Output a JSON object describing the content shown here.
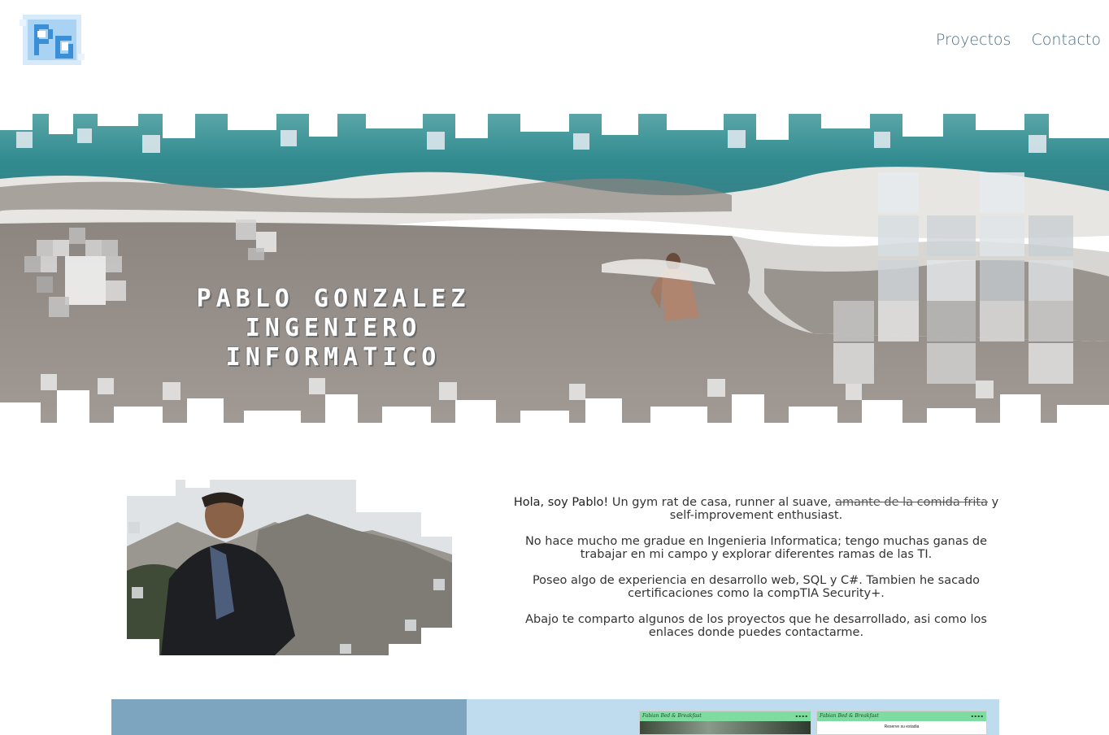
{
  "header": {
    "logo_text": "PG",
    "nav": [
      {
        "label": "Proyectos"
      },
      {
        "label": "Contacto"
      }
    ]
  },
  "hero": {
    "line1": "PABLO GONZALEZ",
    "line2": "INGENIERO INFORMATICO"
  },
  "about": {
    "p1_bold": "Hola, soy Pablo!",
    "p1_text": " Un gym rat de casa, runner al suave, ",
    "p1_strike": "amante de la comida frita",
    "p1_end": " y self-improvement enthusiast.",
    "p2": "No hace mucho me gradue en Ingenieria Informatica; tengo muchas ganas de trabajar en mi campo y explorar diferentes ramas de las TI.",
    "p3": "Poseo algo de experiencia en desarrollo web, SQL y C#. Tambien he sacado certificaciones como la compTIA Security+.",
    "p4": "Abajo te comparto algunos de los proyectos que he desarrollado, asi como los enlaces donde puedes contactarme."
  },
  "projects": {
    "thumb1_title": "Fabian Bed & Breakfast",
    "thumb2_title": "Fabian Bed & Breakfast",
    "thumb2_caption": "Reserve su estadia"
  },
  "colors": {
    "nav": "#4a6e80",
    "proj_left": "#7da5c0",
    "proj_right": "#bfdcef"
  }
}
